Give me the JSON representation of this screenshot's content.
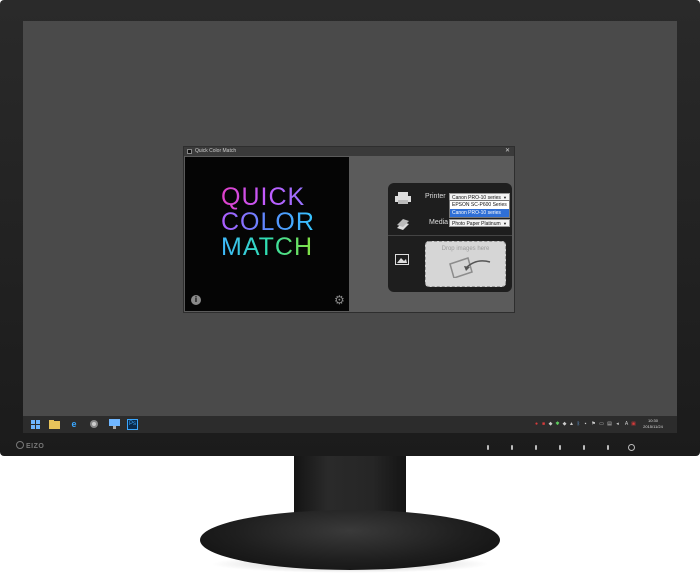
{
  "window": {
    "title": "Quick Color Match",
    "close_glyph": "✕"
  },
  "splash": {
    "brand_lines": [
      "QUICK",
      "COLOR",
      "MATCH"
    ],
    "info_glyph": "i",
    "gear_glyph": "⚙"
  },
  "panel": {
    "printer_label": "Printer",
    "printer_value": "Canon PRO-10 series",
    "printer_options": [
      "EPSON SC-P600 Series",
      "Canon PRO-10 series"
    ],
    "media_label": "Media",
    "media_value": "Photo Paper Platinum",
    "drop_text": "Drop images here",
    "icons": [
      "printer-icon",
      "paper-stack-icon",
      "image-icon",
      "drop-arrow-icon"
    ]
  },
  "taskbar": {
    "buttons": [
      "windows-start-icon",
      "file-explorer-icon",
      "internet-explorer-icon",
      "app-icon",
      "monitor-icon",
      "photoshop-icon"
    ],
    "photoshop_label": "Ps",
    "ime_label": "A",
    "clock_time": "10:30",
    "clock_date": "2015/11/24"
  },
  "monitor": {
    "brand": "EIZO"
  },
  "colors": {
    "screen_bg": "#4a4a4a",
    "panel_bg": "#1e1e1e",
    "selection": "#2f6fd6",
    "brand_gradient": [
      "#e040c8",
      "#9a5cff",
      "#3fa0ff",
      "#2fe0b0",
      "#8ae03a"
    ]
  }
}
